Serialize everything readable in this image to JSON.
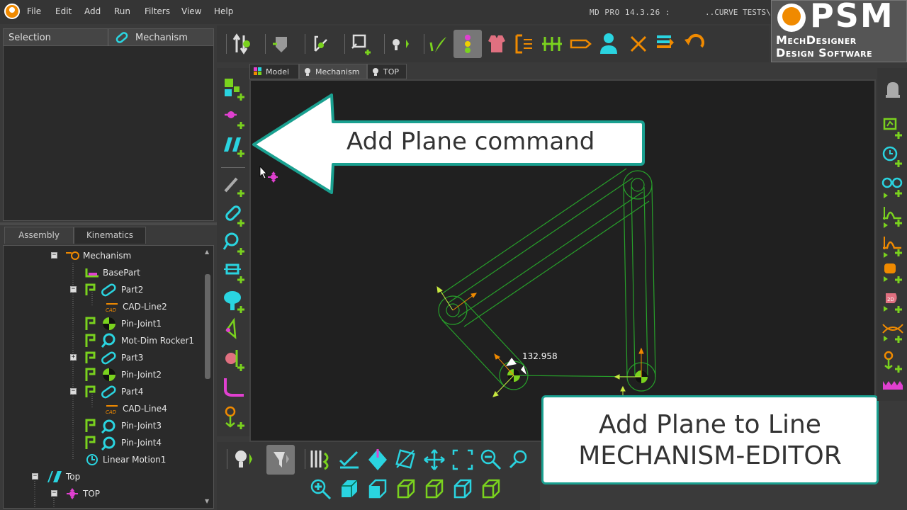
{
  "menu": {
    "items": [
      "File",
      "Edit",
      "Add",
      "Run",
      "Filters",
      "View",
      "Help"
    ],
    "version": "MD PRO 14.3.26 :",
    "document": "..CURVE TESTS\\"
  },
  "brand": {
    "name": "PSM",
    "line1": "MechDesigner",
    "line2": "Design Software"
  },
  "selection_panel": {
    "label": "Selection",
    "context": "Mechanism"
  },
  "tree_tabs": [
    "Assembly",
    "Kinematics"
  ],
  "tree": {
    "items": [
      {
        "label": "Mechanism",
        "icon": "mechanism-icon"
      },
      {
        "label": "BasePart",
        "icon": "basepart-icon"
      },
      {
        "label": "Part2",
        "icon": "part-icon"
      },
      {
        "label": "CAD-Line2",
        "icon": "cad-line-icon"
      },
      {
        "label": "Pin-Joint1",
        "icon": "pin-joint-icon"
      },
      {
        "label": "Mot-Dim Rocker1",
        "icon": "motion-dimension-icon"
      },
      {
        "label": "Part3",
        "icon": "part-icon"
      },
      {
        "label": "Pin-Joint2",
        "icon": "pin-joint-icon"
      },
      {
        "label": "Part4",
        "icon": "part-icon"
      },
      {
        "label": "CAD-Line4",
        "icon": "cad-line-icon"
      },
      {
        "label": "Pin-Joint3",
        "icon": "pin-joint-icon"
      },
      {
        "label": "Pin-Joint4",
        "icon": "pin-joint-icon"
      },
      {
        "label": "Linear Motion1",
        "icon": "linear-motion-icon"
      },
      {
        "label": "Top",
        "icon": "plane-icon"
      },
      {
        "label": "TOP",
        "icon": "sketch-icon"
      }
    ]
  },
  "doc_tabs": [
    "Model",
    "Mechanism",
    "TOP"
  ],
  "callouts": {
    "plane_command": "Add Plane command",
    "editor_line1": "Add Plane to Line",
    "editor_line2": "MECHANISM-EDITOR"
  },
  "viewport": {
    "dimension_value": "132.958"
  },
  "colors": {
    "accent_teal": "#1aa090",
    "icon_green": "#7ad21e",
    "icon_cyan": "#2ad4e0",
    "icon_magenta": "#e040d0",
    "icon_orange": "#f08a00",
    "mechanism_green": "#27a02a"
  }
}
